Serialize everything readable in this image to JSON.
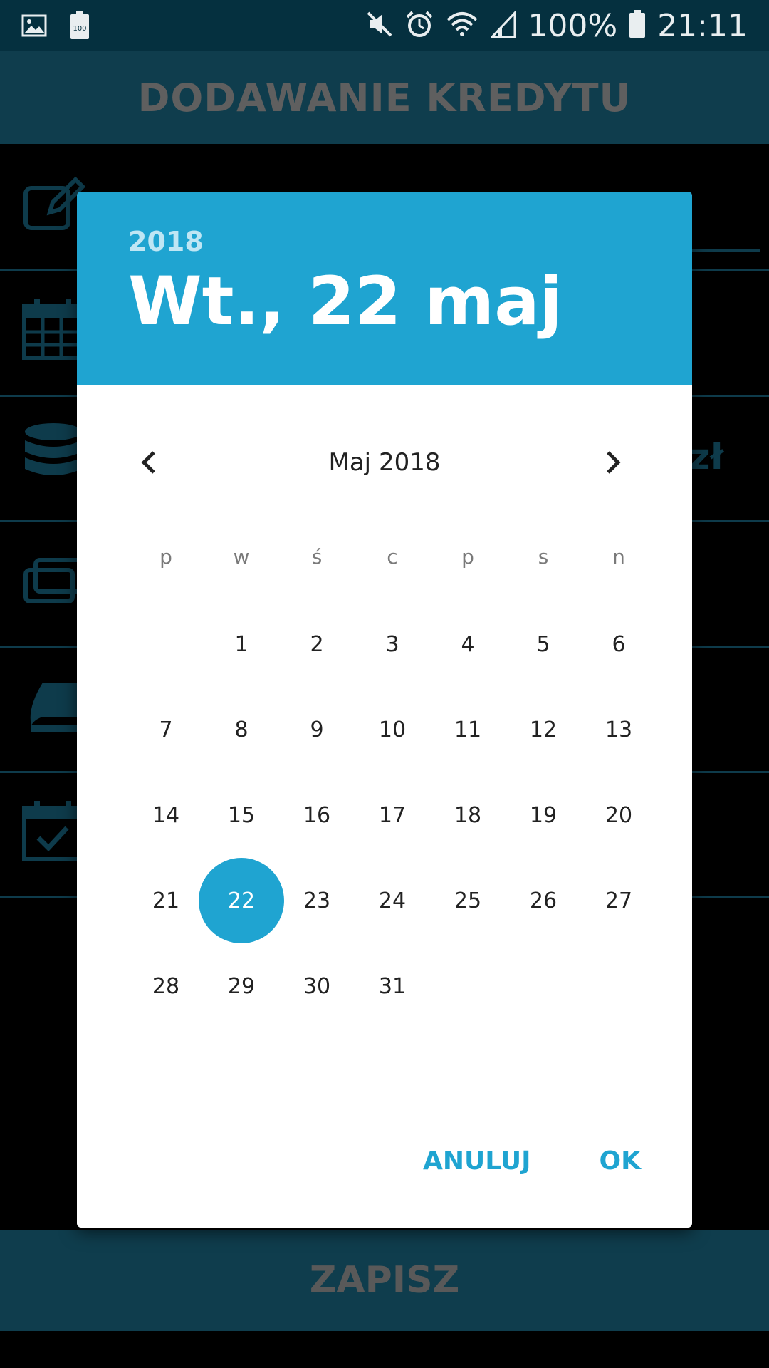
{
  "status_bar": {
    "battery_percent": "100%",
    "time": "21:11",
    "icons": [
      "image-icon",
      "battery-100-icon",
      "mute-icon",
      "alarm-icon",
      "wifi-icon",
      "signal-icon",
      "battery-icon"
    ]
  },
  "app": {
    "title": "DODAWANIE KREDYTU",
    "save_label": "ZAPISZ",
    "amount_suffix": "zł",
    "row_icons": [
      "edit-icon",
      "calendar-icon",
      "database-icon",
      "cards-icon",
      "book-icon",
      "calendar-check-icon"
    ]
  },
  "date_picker": {
    "year": "2018",
    "selected_date": "Wt., 22 maj",
    "month_label": "Maj 2018",
    "weekdays": [
      "p",
      "w",
      "ś",
      "c",
      "p",
      "s",
      "n"
    ],
    "weeks": [
      [
        "",
        "1",
        "2",
        "3",
        "4",
        "5",
        "6"
      ],
      [
        "7",
        "8",
        "9",
        "10",
        "11",
        "12",
        "13"
      ],
      [
        "14",
        "15",
        "16",
        "17",
        "18",
        "19",
        "20"
      ],
      [
        "21",
        "22",
        "23",
        "24",
        "25",
        "26",
        "27"
      ],
      [
        "28",
        "29",
        "30",
        "31",
        "",
        "",
        ""
      ]
    ],
    "selected_day": "22",
    "cancel_label": "ANULUJ",
    "ok_label": "OK"
  },
  "colors": {
    "accent": "#1fa4d1",
    "header_dark": "#0f3d4d",
    "status_bar": "#05303f"
  }
}
